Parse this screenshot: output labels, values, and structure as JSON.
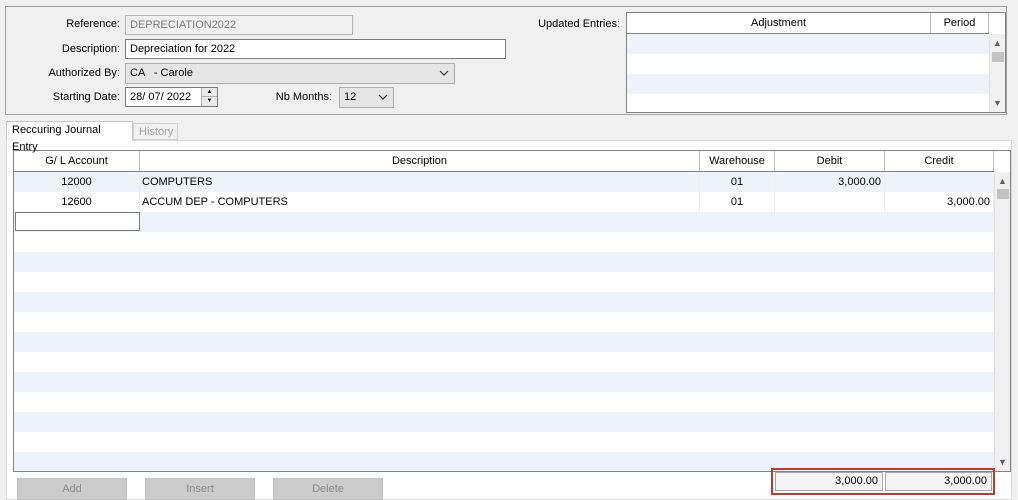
{
  "header": {
    "reference_label": "Reference:",
    "reference_value": "DEPRECIATION2022",
    "description_label": "Description:",
    "description_value": "Depreciation for 2022",
    "authorized_label": "Authorized By:",
    "authorized_value": "CA   - Carole",
    "starting_date_label": "Starting Date:",
    "starting_date_value": "28/ 07/ 2022",
    "nb_months_label": "Nb Months:",
    "nb_months_value": "12",
    "updated_entries_label": "Updated Entries:"
  },
  "updated_grid": {
    "columns": [
      "Adjustment",
      "Period"
    ]
  },
  "tabs": [
    {
      "label": "Reccuring Journal Entry",
      "active": true
    },
    {
      "label": "History",
      "active": false
    }
  ],
  "journal_grid": {
    "columns": [
      "G/ L Account",
      "Description",
      "Warehouse",
      "Debit",
      "Credit"
    ],
    "rows": [
      {
        "account": "12000",
        "description": "COMPUTERS",
        "warehouse": "01",
        "debit": "3,000.00",
        "credit": ""
      },
      {
        "account": "12600",
        "description": "ACCUM DEP - COMPUTERS",
        "warehouse": "01",
        "debit": "",
        "credit": "3,000.00"
      }
    ]
  },
  "buttons": {
    "add": "Add",
    "insert": "Insert",
    "delete": "Delete"
  },
  "totals": {
    "debit": "3,000.00",
    "credit": "3,000.00",
    "highlight_color": "#c0392b"
  }
}
